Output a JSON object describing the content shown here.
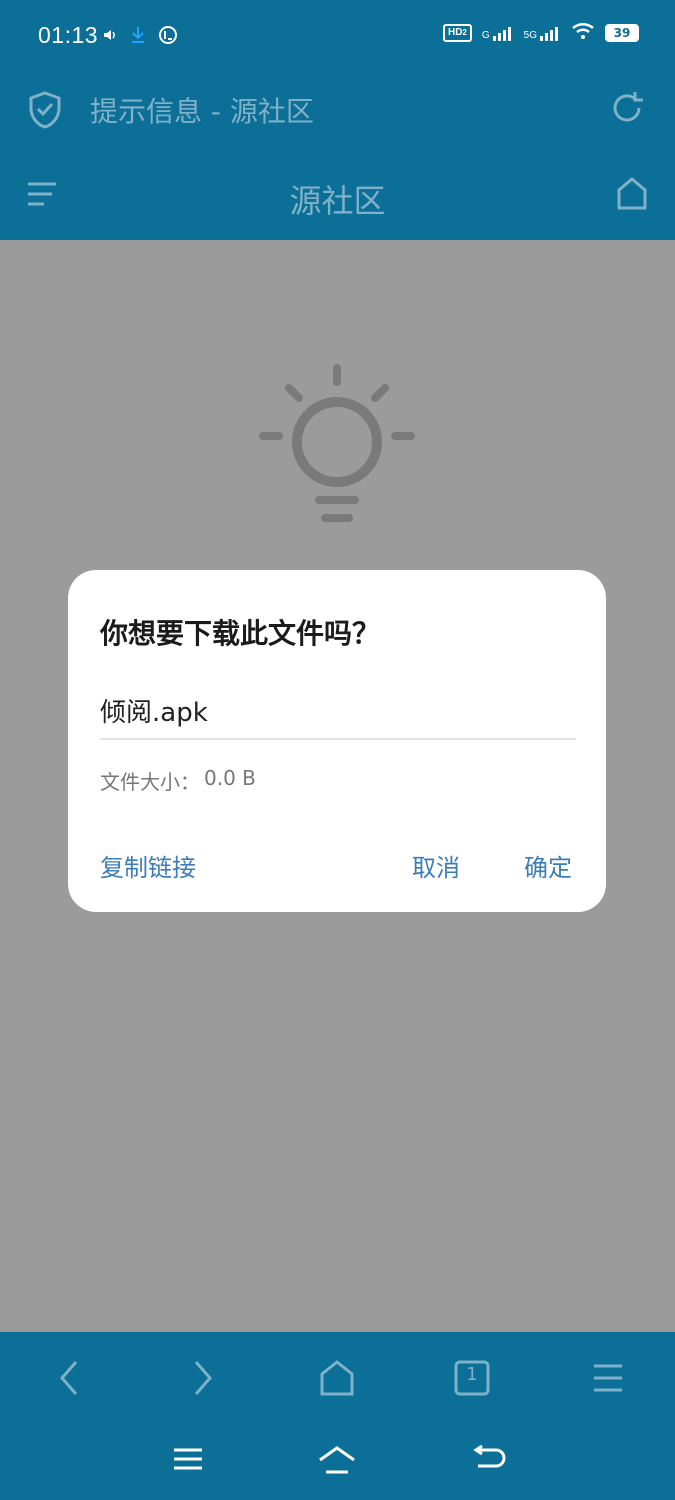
{
  "status": {
    "time": "01:13",
    "left_icons": [
      "volume-icon",
      "download-icon",
      "data-icon"
    ],
    "right_icons": [
      "hd-icon",
      "g-signal-icon",
      "5g-signal-icon",
      "wifi-icon",
      "battery-icon"
    ],
    "hd_label": "HD",
    "hd_sub": "2",
    "g_label": "G",
    "fiveg_label": "5G",
    "battery": "39"
  },
  "titlebar": {
    "title": "提示信息 - 源社区"
  },
  "navbar": {
    "title": "源社区"
  },
  "dialog": {
    "title": "你想要下载此文件吗？",
    "filename": "倾阅.apk",
    "size_label": "文件大小：",
    "size_value": "0.0 B",
    "copy_link": "复制链接",
    "cancel": "取消",
    "confirm": "确定"
  },
  "toolbar": {
    "tab_count": "1"
  },
  "colors": {
    "primary": "#0b6f97",
    "overlay_bg": "#9b9b9b",
    "accent_text": "#3b7db9",
    "muted_title": "#7fb1c8"
  }
}
